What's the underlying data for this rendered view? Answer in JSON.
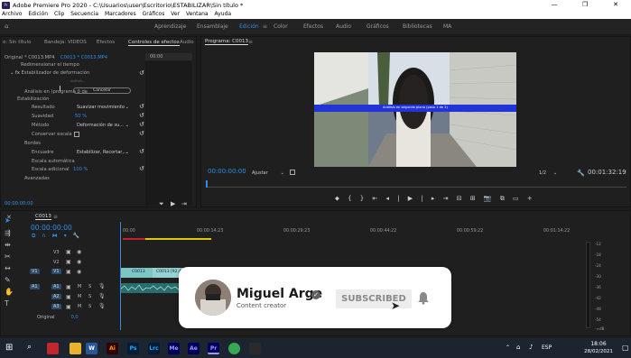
{
  "titlebar": {
    "title": "Adobe Premiere Pro 2020 - C:\\Usuarios\\user\\Escritorio\\ESTABILIZAR\\Sin título *",
    "minimize": "—",
    "maximize": "❐",
    "close": "✕"
  },
  "menu": [
    "Archivo",
    "Edición",
    "Clip",
    "Secuencia",
    "Marcadores",
    "Gráficos",
    "Ver",
    "Ventana",
    "Ayuda"
  ],
  "workspaces": [
    "Aprendizaje",
    "Ensamblaje",
    "Edición",
    "Color",
    "Efectos",
    "Audio",
    "Gráficos",
    "Bibliotecas",
    "MA"
  ],
  "effects_panel": {
    "tabs": [
      "o: Sin título",
      "Bandeja: VIDEOS",
      "Efectos",
      "Controles de efectos",
      "Audio"
    ],
    "source": "Original * C0013.MP4",
    "clip": "C0013 * C0013.MP4",
    "timecode_top": "00:00",
    "rows": {
      "resize": "Redimensionar el tiempo",
      "stabilizer": "Estabilizador de deformación",
      "analyze_note": "Análisis...",
      "analyze_pre": "Análisis en",
      "analyze_step": "programa 0 de",
      "cancel_button": "Cancelar",
      "stabilization": "Estabilización",
      "result_label": "Resultado",
      "result_value": "Suavizar movimiento",
      "smooth_label": "Suavidad",
      "smooth_value": "50 %",
      "method_label": "Método",
      "method_value": "Deformación de su...",
      "preserve_label": "Conservar escala",
      "borders": "Bordes",
      "frame_label": "Encuadre",
      "frame_value": "Estabilizar, Recortar,...",
      "autoscale": "Escala automática",
      "addscale_label": "Escala adicional",
      "addscale_value": "100 %",
      "advanced": "Avanzadas"
    },
    "bottom_time": "00:00:00:00"
  },
  "program": {
    "title": "Programa: C0013",
    "overlay_text": "Análisis en segundo plano (paso 1 de 2)",
    "time_current": "00:00:00:00",
    "fit": "Ajustar",
    "scale": "1/2",
    "duration": "00:01:32:19",
    "transport": [
      "⬥",
      "{",
      "}",
      "⇤",
      "◂|",
      "▶",
      "|▸",
      "⇥",
      "⊟",
      "⊞",
      "📷",
      "⧉",
      "▭",
      "+"
    ]
  },
  "timeline": {
    "title": "C0013",
    "time": "00:00:00:00",
    "ruler": [
      "00:00",
      "00:00:14:23",
      "00:00:29:23",
      "00:00:44:22",
      "00:00:59:22",
      "00:01:14:22"
    ],
    "tracks": [
      {
        "name": "V3"
      },
      {
        "name": "V2"
      },
      {
        "name": "V1",
        "target": "V1"
      },
      {
        "name": "A1",
        "target": "A1"
      },
      {
        "name": "A2"
      },
      {
        "name": "A3"
      }
    ],
    "master_label": "Original",
    "master_value": "0,0",
    "clip_v1_a": "C0013",
    "clip_v1_b": "C0013 [92,43%]",
    "levels": [
      "-12",
      "-18",
      "-24",
      "-30",
      "-36",
      "-42",
      "-48",
      "-54",
      "-∞dB"
    ]
  },
  "subscribe": {
    "name": "Miguel Arge",
    "verified": "✓",
    "subtitle": "Content creator",
    "button": "SUBSCRIBED"
  },
  "taskbar": {
    "apps": [
      {
        "label": "",
        "color": "#c1272d",
        "fg": "#fff"
      },
      {
        "label": "",
        "color": "#e8b32a",
        "fg": "#fff"
      },
      {
        "label": "W",
        "color": "#2b579a",
        "fg": "#fff"
      },
      {
        "label": "Ai",
        "color": "#330000",
        "fg": "#ff9a00"
      },
      {
        "label": "Ps",
        "color": "#001e36",
        "fg": "#31a8ff"
      },
      {
        "label": "Lrc",
        "color": "#001e36",
        "fg": "#31a8ff"
      },
      {
        "label": "Me",
        "color": "#00005b",
        "fg": "#9999ff"
      },
      {
        "label": "Ae",
        "color": "#00005b",
        "fg": "#9999ff"
      },
      {
        "label": "Pr",
        "color": "#00005b",
        "fg": "#9999ff"
      },
      {
        "label": "",
        "color": "#34a853",
        "fg": "#fff"
      },
      {
        "label": "",
        "color": "#2a2a2a",
        "fg": "#fff"
      }
    ],
    "lang": "ESP",
    "time": "18:06",
    "date": "28/02/2021"
  }
}
